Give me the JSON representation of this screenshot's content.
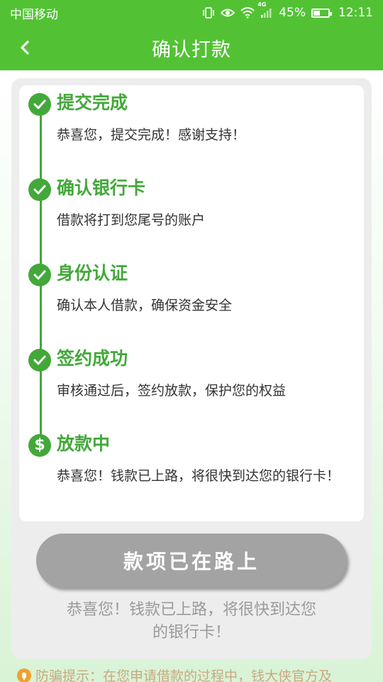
{
  "status_bar": {
    "carrier": "中国移动",
    "network": "4G",
    "battery_percent": "45%",
    "battery_level": 0.45,
    "time": "12:11"
  },
  "header": {
    "title": "确认打款",
    "back_icon": "chevron-left-icon"
  },
  "steps": [
    {
      "title": "提交完成",
      "desc": "恭喜您，提交完成！感谢支持！",
      "icon": "check-circle-icon"
    },
    {
      "title": "确认银行卡",
      "desc": "借款将打到您尾号的账户",
      "icon": "check-circle-icon"
    },
    {
      "title": "身份认证",
      "desc": "确认本人借款，确保资金安全",
      "icon": "check-circle-icon"
    },
    {
      "title": "签约成功",
      "desc": "审核通过后，签约放款，保护您的权益",
      "icon": "check-circle-icon"
    },
    {
      "title": "放款中",
      "desc": "恭喜您！钱款已上路，将很快到达您的银行卡！",
      "icon": "dollar-circle-icon"
    }
  ],
  "action": {
    "button_label": "款项已在路上",
    "message_line1": "恭喜您！钱款已上路，将很快到达您",
    "message_line2": "的银行卡！"
  },
  "tip": {
    "text": "防骗提示：在您申请借款的过程中，钱大侠官方及",
    "icon": "location-pin-icon"
  },
  "colors": {
    "brand_green": "#52c234",
    "step_green": "#43a83a",
    "button_gray": "#a3a3a3",
    "tip_orange": "#f0a030"
  }
}
